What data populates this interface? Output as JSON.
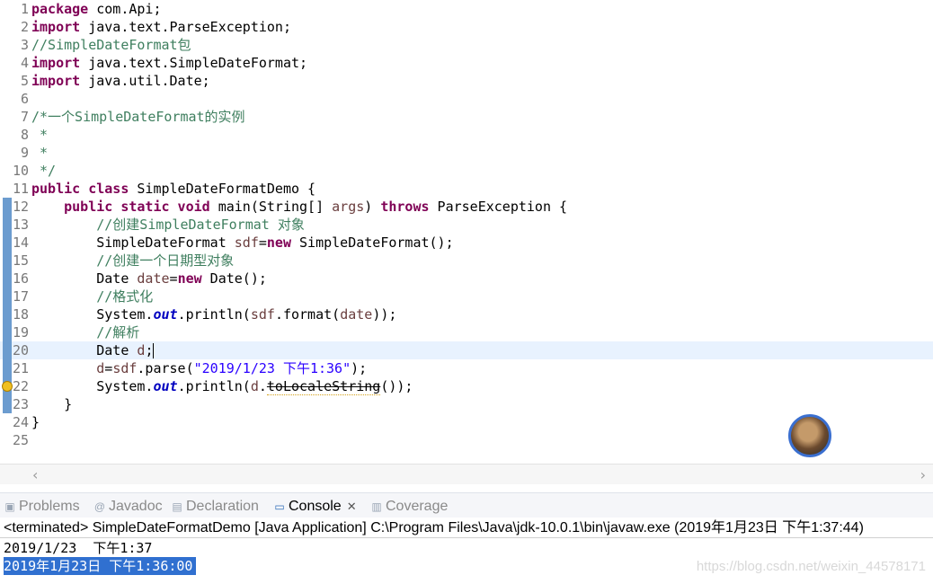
{
  "editor": {
    "line_numbers": [
      "1",
      "2",
      "3",
      "4",
      "5",
      "6",
      "7",
      "8",
      "9",
      "10",
      "11",
      "12",
      "13",
      "14",
      "15",
      "16",
      "17",
      "18",
      "19",
      "20",
      "21",
      "22",
      "23",
      "24",
      "25"
    ],
    "lines": {
      "l1": {
        "kw": "package",
        "rest": " com.Api;"
      },
      "l2": {
        "kw": "import",
        "rest": " java.text.ParseException;"
      },
      "l3": {
        "cm": "//SimpleDateFormat包"
      },
      "l4": {
        "kw": "import",
        "rest": " java.text.SimpleDateFormat;"
      },
      "l5": {
        "kw": "import",
        "rest": " java.util.Date;"
      },
      "l7": {
        "cm": "/*一个SimpleDateFormat的实例"
      },
      "l8": {
        "cm": " *"
      },
      "l9": {
        "cm": " *"
      },
      "l10": {
        "cm": " */"
      },
      "l11": {
        "kw": "public class",
        "rest": " SimpleDateFormatDemo {"
      },
      "l12": {
        "indent": "    ",
        "kw": "public static void",
        "rest1": " main(String[] ",
        "var": "args",
        "rest2": ") ",
        "kw2": "throws",
        "rest3": " ParseException {"
      },
      "l13": {
        "indent": "        ",
        "cm": "//创建SimpleDateFormat 对象"
      },
      "l14": {
        "indent": "        ",
        "rest1": "SimpleDateFormat ",
        "var": "sdf",
        "rest2": "=",
        "kw": "new",
        "rest3": " SimpleDateFormat();"
      },
      "l15": {
        "indent": "        ",
        "cm": "//创建一个日期型对象"
      },
      "l16": {
        "indent": "        ",
        "rest1": "Date ",
        "var": "date",
        "rest2": "=",
        "kw": "new",
        "rest3": " Date();"
      },
      "l17": {
        "indent": "        ",
        "cm": "//格式化"
      },
      "l18": {
        "indent": "        ",
        "rest1": "System.",
        "fld": "out",
        "rest2": ".println(",
        "var1": "sdf",
        "rest3": ".format(",
        "var2": "date",
        "rest4": "));"
      },
      "l19": {
        "indent": "        ",
        "cm": "//解析"
      },
      "l20": {
        "indent": "        ",
        "rest1": "Date ",
        "var": "d",
        "rest2": ";"
      },
      "l21": {
        "indent": "        ",
        "var1": "d",
        "rest1": "=",
        "var2": "sdf",
        "rest2": ".parse(",
        "str": "\"2019/1/23 下午1:36\"",
        "rest3": ");"
      },
      "l22": {
        "indent": "        ",
        "rest1": "System.",
        "fld": "out",
        "rest2": ".println(",
        "var": "d",
        "rest3": ".",
        "dep": "toLocaleString",
        "rest4": "());"
      },
      "l23": {
        "text": "    }"
      },
      "l24": {
        "text": "}"
      }
    }
  },
  "scroll": {
    "left": "‹",
    "right": "›"
  },
  "tabs": [
    {
      "label": "Problems",
      "icon": "problems-icon",
      "glyph": "▣"
    },
    {
      "label": "Javadoc",
      "icon": "javadoc-icon",
      "glyph": "@"
    },
    {
      "label": "Declaration",
      "icon": "declaration-icon",
      "glyph": "▤"
    },
    {
      "label": "Console",
      "icon": "console-icon",
      "glyph": "▭",
      "close": "✕"
    },
    {
      "label": "Coverage",
      "icon": "coverage-icon",
      "glyph": "▥"
    }
  ],
  "console": {
    "terminated": "<terminated> SimpleDateFormatDemo [Java Application] C:\\Program Files\\Java\\jdk-10.0.1\\bin\\javaw.exe (2019年1月23日 下午1:37:44)",
    "output": [
      "2019/1/23  下午1:37",
      "2019年1月23日 下午1:36:00"
    ],
    "watermark": "https://blog.csdn.net/weixin_44578171"
  }
}
